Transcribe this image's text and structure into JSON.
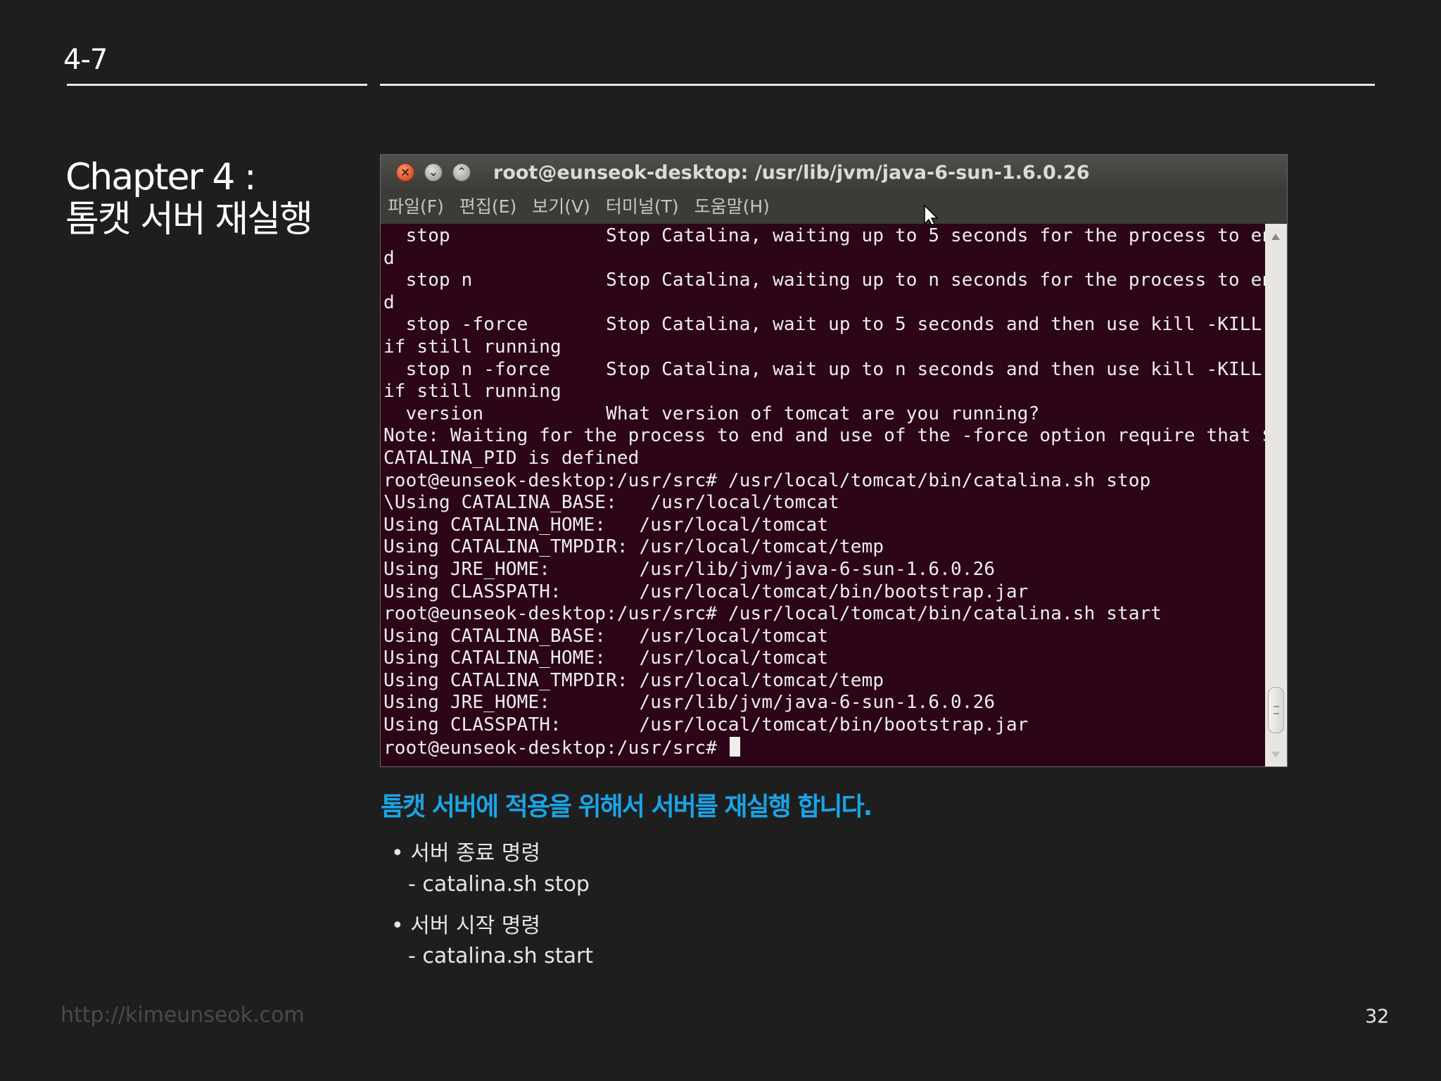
{
  "slide": {
    "section_number": "4-7",
    "chapter_title_line1": "Chapter 4 :",
    "chapter_title_line2": "톰캣 서버 재실행",
    "headline": "톰캣 서버에 적용을 위해서 서버를 재실행 합니다.",
    "bullets": [
      {
        "marker": "•",
        "text": "서버 종료 명령"
      },
      {
        "marker": "-",
        "text": "catalina.sh stop"
      },
      {
        "marker": "•",
        "text": "서버 시작 명령"
      },
      {
        "marker": "-",
        "text": "catalina.sh start"
      }
    ],
    "footer_url": "http://kimeunseok.com",
    "page_number": "32"
  },
  "terminal": {
    "window_title": "root@eunseok-desktop: /usr/lib/jvm/java-6-sun-1.6.0.26",
    "menu": [
      "파일(F)",
      "편집(E)",
      "보기(V)",
      "터미널(T)",
      "도움말(H)"
    ],
    "close_glyph": "×",
    "minimize_glyph": "⌄",
    "maximize_glyph": "⌃",
    "lines": [
      "  stop              Stop Catalina, waiting up to 5 seconds for the process to en",
      "d",
      "  stop n            Stop Catalina, waiting up to n seconds for the process to en",
      "d",
      "  stop -force       Stop Catalina, wait up to 5 seconds and then use kill -KILL",
      "if still running",
      "  stop n -force     Stop Catalina, wait up to n seconds and then use kill -KILL",
      "if still running",
      "  version           What version of tomcat are you running?",
      "Note: Waiting for the process to end and use of the -force option require that $",
      "CATALINA_PID is defined",
      "root@eunseok-desktop:/usr/src# /usr/local/tomcat/bin/catalina.sh stop",
      "\\Using CATALINA_BASE:   /usr/local/tomcat",
      "Using CATALINA_HOME:   /usr/local/tomcat",
      "Using CATALINA_TMPDIR: /usr/local/tomcat/temp",
      "Using JRE_HOME:        /usr/lib/jvm/java-6-sun-1.6.0.26",
      "Using CLASSPATH:       /usr/local/tomcat/bin/bootstrap.jar",
      "root@eunseok-desktop:/usr/src# /usr/local/tomcat/bin/catalina.sh start",
      "Using CATALINA_BASE:   /usr/local/tomcat",
      "Using CATALINA_HOME:   /usr/local/tomcat",
      "Using CATALINA_TMPDIR: /usr/local/tomcat/temp",
      "Using JRE_HOME:        /usr/lib/jvm/java-6-sun-1.6.0.26",
      "Using CLASSPATH:       /usr/local/tomcat/bin/bootstrap.jar"
    ],
    "prompt": "root@eunseok-desktop:/usr/src# ",
    "colors": {
      "background": "#2c0518",
      "text": "#eeeeec",
      "titlebar": "#3c3b37",
      "close_button": "#d95026"
    }
  },
  "accent_color": "#1aa4e6"
}
